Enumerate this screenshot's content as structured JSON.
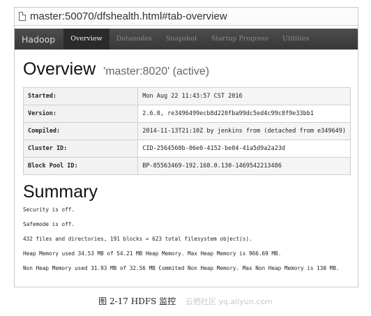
{
  "browser": {
    "url": "master:50070/dfshealth.html#tab-overview"
  },
  "navbar": {
    "brand": "Hadoop",
    "items": [
      {
        "label": "Overview"
      },
      {
        "label": "Datanodes"
      },
      {
        "label": "Snapshot"
      },
      {
        "label": "Startup Progress"
      },
      {
        "label": "Utilities"
      }
    ]
  },
  "overview": {
    "title": "Overview",
    "subtitle": "'master:8020' (active)",
    "rows": [
      {
        "key": "Started:",
        "value": "Mon Aug 22 11:43:57 CST 2016"
      },
      {
        "key": "Version:",
        "value": "2.6.0, re3496499ecb8d220fba99dc5ed4c99c8f9e33bb1"
      },
      {
        "key": "Compiled:",
        "value": "2014-11-13T21:10Z by jenkins from (detached from e349649)"
      },
      {
        "key": "Cluster ID:",
        "value": "CID-2564560b-06e0-4152-be04-41a5d9a2a23d"
      },
      {
        "key": "Block Pool ID:",
        "value": "BP-85563469-192.168.0.130-1469542213486"
      }
    ]
  },
  "summary": {
    "title": "Summary",
    "lines": [
      "Security is off.",
      "Safemode is off.",
      "432 files and directories, 191 blocks = 623 total filesystem object(s).",
      "Heap Memory used 34.53 MB of 54.21 MB Heap Memory. Max Heap Memory is 966.69 MB.",
      "Non Heap Memory used 31.93 MB of 32.56 MB Commited Non Heap Memory. Max Non Heap Memory is 130 MB."
    ]
  },
  "caption": {
    "text": "图 2-17   HDFS 监控",
    "watermark": "云栖社区 yq.aliyun.com"
  }
}
